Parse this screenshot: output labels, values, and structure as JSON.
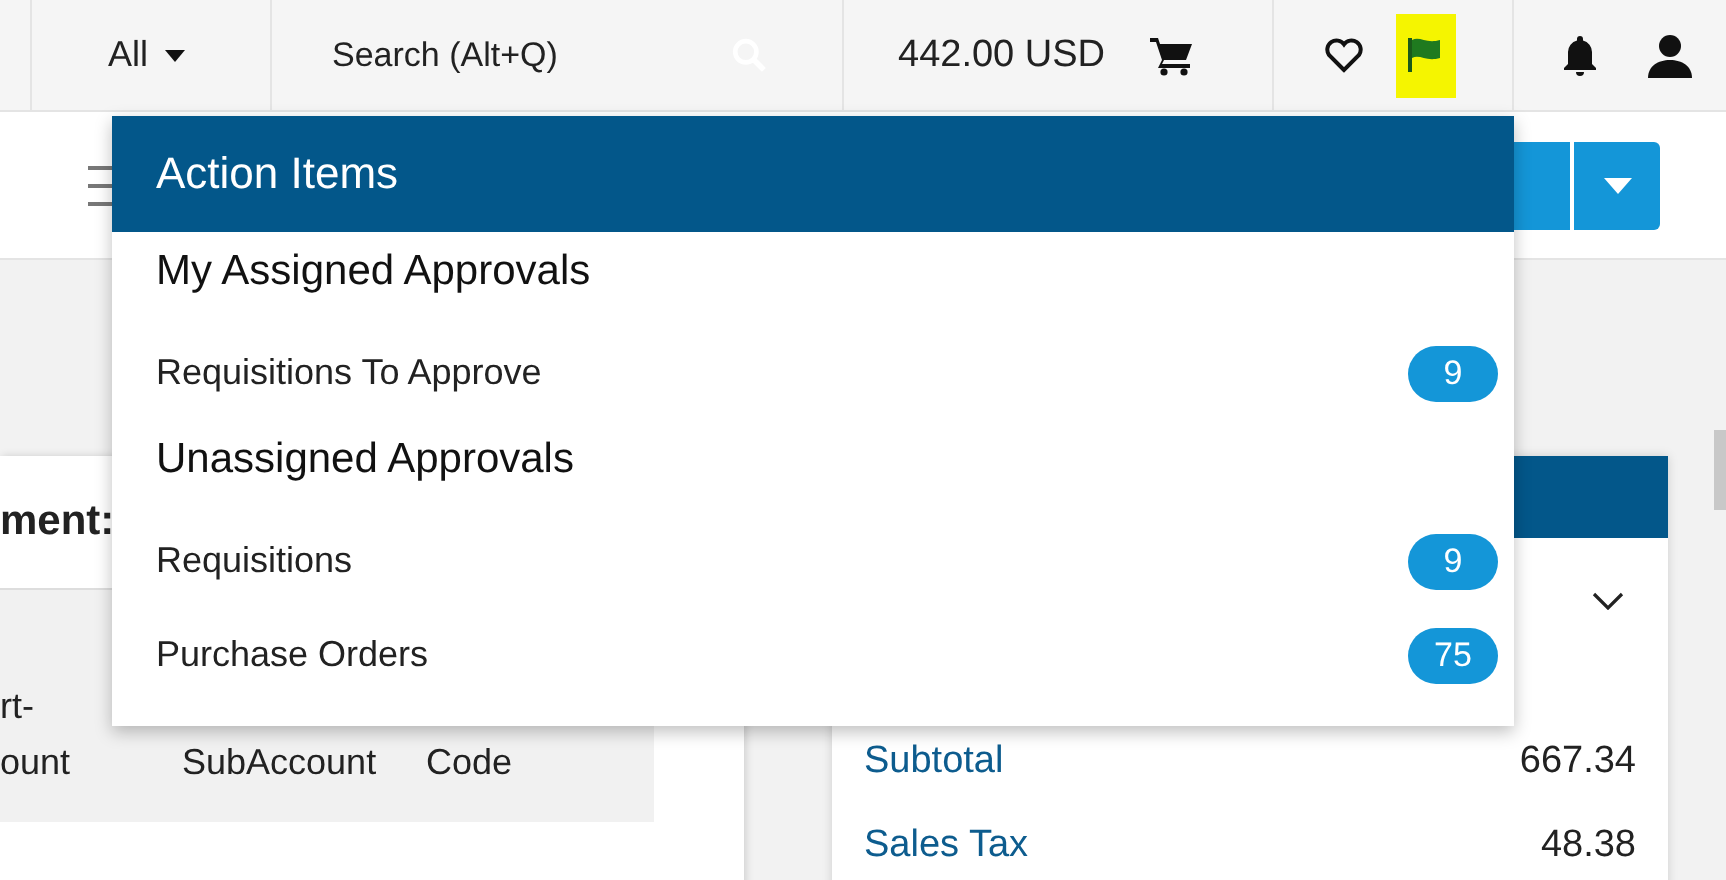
{
  "top_bar": {
    "scope_selector": "All",
    "search": {
      "placeholder": "Search (Alt+Q)"
    },
    "cart_total": "442.00 USD",
    "flag_highlighted": true
  },
  "action_items_menu": {
    "title": "Action Items",
    "sections": [
      {
        "heading": "My Assigned Approvals",
        "items": [
          {
            "label": "Requisitions To Approve",
            "count": "9"
          }
        ]
      },
      {
        "heading": "Unassigned Approvals",
        "items": [
          {
            "label": "Requisitions",
            "count": "9"
          },
          {
            "label": "Purchase Orders",
            "count": "75"
          }
        ]
      }
    ]
  },
  "assignment_panel": {
    "heading": "ment:",
    "table": {
      "columns": [
        "rt-\nount",
        "SubAccount",
        "Code"
      ]
    }
  },
  "summary_panel": {
    "rows": [
      {
        "label": "Subtotal",
        "value": "667.34"
      },
      {
        "label": "Sales Tax",
        "value": "48.38"
      }
    ]
  }
}
